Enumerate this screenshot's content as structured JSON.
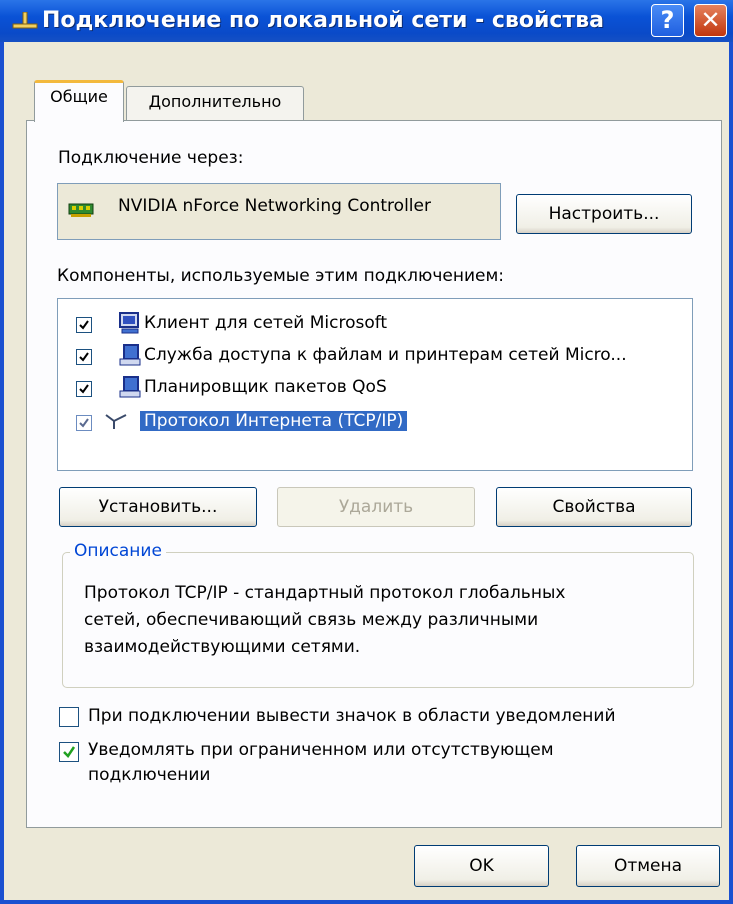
{
  "window": {
    "title": "Подключение по локальной сети - свойства",
    "help_glyph": "?",
    "close_glyph": "✕"
  },
  "tabs": [
    {
      "label": "Общие",
      "active": true
    },
    {
      "label": "Дополнительно",
      "active": false
    }
  ],
  "connect_via": {
    "label": "Подключение через:",
    "adapter_name": "NVIDIA nForce Networking Controller",
    "configure_button": "Настроить..."
  },
  "components": {
    "label": "Компоненты, используемые этим подключением:",
    "items": [
      {
        "label": "Клиент для сетей Microsoft",
        "checked": true,
        "icon": "network-client-icon"
      },
      {
        "label": "Служба доступа к файлам и принтерам сетей Micro...",
        "checked": true,
        "icon": "network-service-icon"
      },
      {
        "label": "Планировщик пакетов QoS",
        "checked": true,
        "icon": "network-service-icon"
      },
      {
        "label": "Протокол Интернета (TCP/IP)",
        "checked": true,
        "selected": true,
        "icon": "network-protocol-icon"
      }
    ]
  },
  "buttons": {
    "install": "Установить...",
    "remove": "Удалить",
    "properties": "Свойства"
  },
  "description": {
    "title": "Описание",
    "lines": [
      "Протокол TCP/IP - стандартный протокол глобальных",
      "сетей, обеспечивающий связь между различными",
      "взаимодействующими сетями."
    ]
  },
  "options": {
    "show_icon": {
      "label": "При подключении вывести значок в области уведомлений",
      "checked": false
    },
    "notify": {
      "line1": "Уведомлять при ограниченном или отсутствующем",
      "line2": "подключении",
      "checked": true
    }
  },
  "footer": {
    "ok": "OK",
    "cancel": "Отмена"
  },
  "colors": {
    "titlebar": "#0a52d6",
    "selection": "#316ac5",
    "group_title": "#0046d5",
    "tab_highlight": "#f3b93d"
  }
}
